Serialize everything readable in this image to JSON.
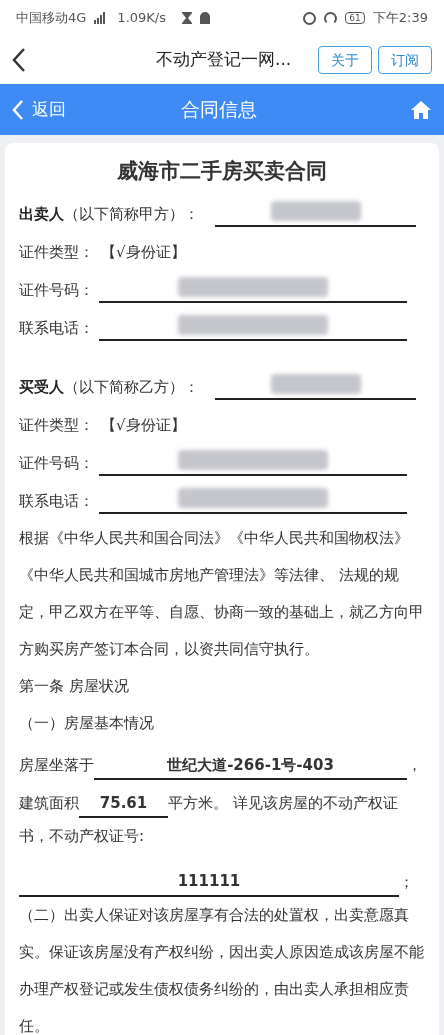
{
  "status_bar": {
    "carrier": "中国移动4G",
    "speed": "1.09K/s",
    "battery": "61",
    "time": "下午2:39"
  },
  "nav_bar": {
    "title": "不动产登记一网...",
    "buttons": [
      "关于",
      "订阅"
    ]
  },
  "header": {
    "back": "返回",
    "title": "合同信息"
  },
  "contract": {
    "title": "威海市二手房买卖合同",
    "parties": [
      {
        "role": "出卖人",
        "note": "（以下简称甲方）：",
        "fields": [
          {
            "label": "证件类型：",
            "kind": "text",
            "value": "【√身份证】"
          },
          {
            "label": "证件号码：",
            "kind": "redacted"
          },
          {
            "label": "联系电话：",
            "kind": "redacted"
          }
        ]
      },
      {
        "role": "买受人",
        "note": "（以下简称乙方）：",
        "fields": [
          {
            "label": "证件类型：",
            "kind": "text",
            "value": "【√身份证】"
          },
          {
            "label": "证件号码：",
            "kind": "redacted"
          },
          {
            "label": "联系电话：",
            "kind": "redacted"
          }
        ]
      }
    ],
    "blocks": [
      {
        "kind": "text",
        "text": "根据《中华人民共和国合同法》《中华人民共和国物权法》《中华人民共和国城市房地产管理法》等法律、 法规的规定，甲乙双方在平等、自愿、协商一致的基础上，就乙方向甲方购买房产签订本合同，以资共同信守执行。"
      },
      {
        "kind": "text",
        "text": "第一条   房屋状况"
      },
      {
        "kind": "text",
        "text": "（一）房屋基本情况"
      },
      {
        "kind": "location",
        "label": "房屋坐落于",
        "value": "世纪大道-266-1号-403",
        "suffix": "，"
      },
      {
        "kind": "area",
        "label": "建筑面积",
        "value": "75.61",
        "suffix": "平方米。 详见该房屋的不动产权证"
      },
      {
        "kind": "text",
        "text": "书，不动产权证号:"
      },
      {
        "kind": "cert",
        "value": "111111",
        "suffix": "；"
      },
      {
        "kind": "text",
        "text": "（二）出卖人保证对该房屋享有合法的处置权，出卖意愿真实。保证该房屋没有产权纠纷，因出卖人原因造成该房屋不能办理产权登记或发生债权债务纠纷的，由出卖人承担相应责任。"
      }
    ]
  }
}
